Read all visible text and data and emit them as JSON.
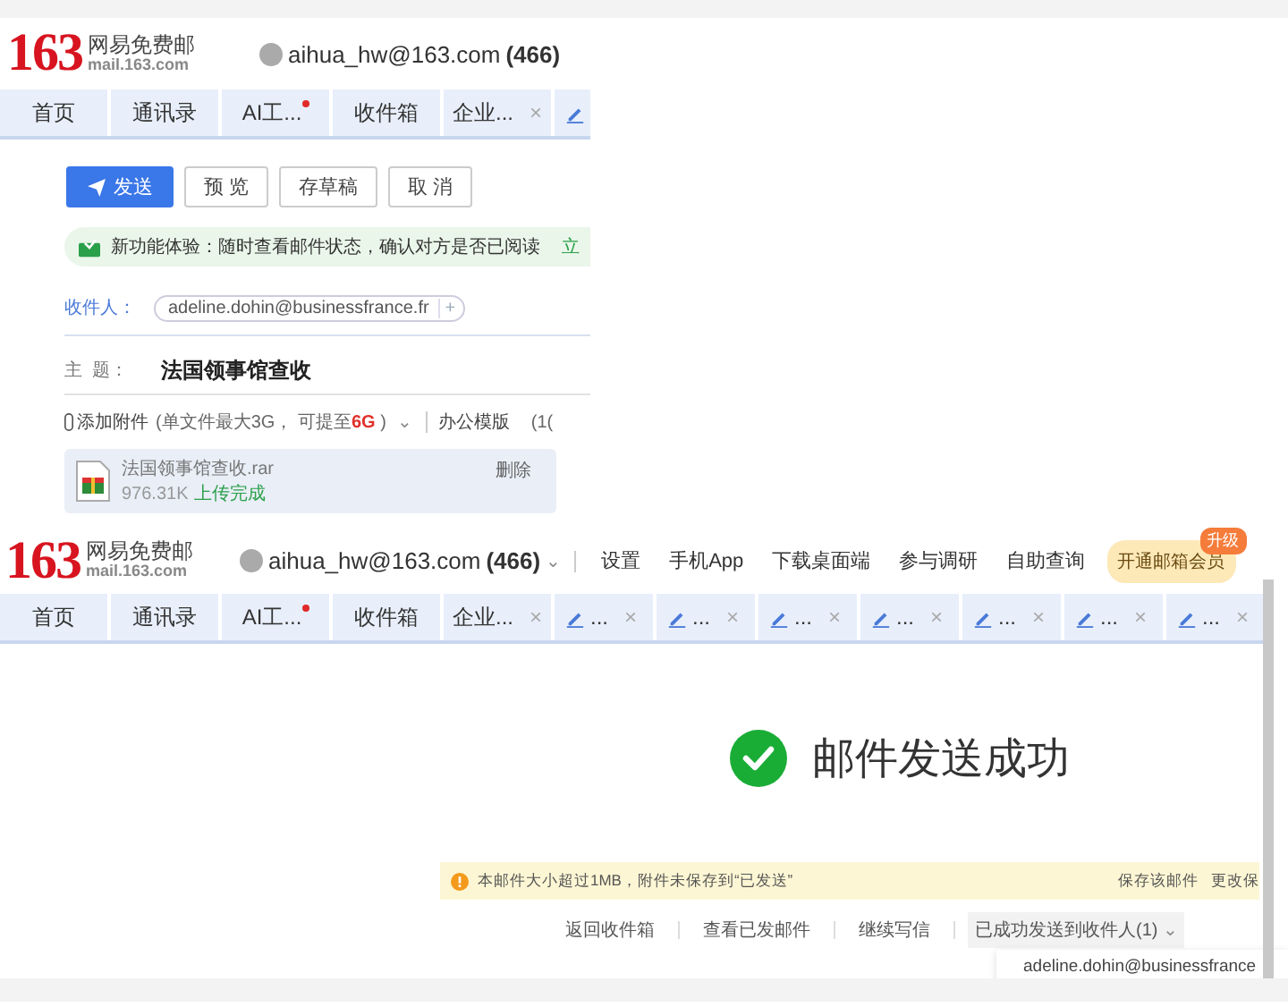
{
  "compose_screen": {
    "logo": {
      "number": "163",
      "name": "网易免费邮",
      "domain": "mail.163.com"
    },
    "account": {
      "email": "aihua_hw@163.com",
      "unread": "(466)"
    },
    "tabs": [
      {
        "kind": "text",
        "label": "首页",
        "dot": false,
        "closable": false
      },
      {
        "kind": "text",
        "label": "通讯录",
        "dot": false,
        "closable": false
      },
      {
        "kind": "text",
        "label": "AI工...",
        "dot": true,
        "closable": false
      },
      {
        "kind": "text",
        "label": "收件箱",
        "dot": false,
        "closable": false
      },
      {
        "kind": "text",
        "label": "企业...",
        "dot": false,
        "closable": true,
        "close": "×"
      },
      {
        "kind": "draft"
      }
    ],
    "toolbar": [
      {
        "kind": "primary",
        "label": "发送"
      },
      {
        "kind": "plain",
        "label": "预 览"
      },
      {
        "kind": "plain",
        "label": "存草稿"
      },
      {
        "kind": "plain",
        "label": "取 消"
      }
    ],
    "notice": {
      "text": "新功能体验：随时查看邮件状态，确认对方是否已阅读",
      "link": "立"
    },
    "recipient": {
      "label": "收件人：",
      "chip": "adeline.dohin@businessfrance.fr",
      "add": "+"
    },
    "subject": {
      "label": "主  题：",
      "value": "法国领事馆查收"
    },
    "attach_bar": {
      "add": "添加附件",
      "limit": "(单文件最大3G， 可提至**6G** )",
      "caret": "⌄",
      "template": "办公模版",
      "more": "(1("
    },
    "attachment": {
      "name": "法国领事馆查收.rar",
      "size": "976.31K",
      "status": "上传完成",
      "delete": "删除"
    }
  },
  "sent_screen": {
    "logo": {
      "number": "163",
      "name": "网易免费邮",
      "domain": "mail.163.com"
    },
    "account": {
      "email": "aihua_hw@163.com",
      "unread": "(466)",
      "caret": "⌄"
    },
    "nav": [
      "设置",
      "手机App",
      "下载桌面端",
      "参与调研",
      "自助查询"
    ],
    "vip": {
      "label": "开通邮箱会员",
      "badge": "升级"
    },
    "tabs": [
      {
        "kind": "text",
        "label": "首页",
        "dot": false,
        "closable": false
      },
      {
        "kind": "text",
        "label": "通讯录",
        "dot": false,
        "closable": false
      },
      {
        "kind": "text",
        "label": "AI工...",
        "dot": true,
        "closable": false
      },
      {
        "kind": "text",
        "label": "收件箱",
        "dot": false,
        "closable": false
      },
      {
        "kind": "text",
        "label": "企业...",
        "dot": false,
        "closable": true,
        "close": "×"
      },
      {
        "kind": "draft",
        "label": "...",
        "dot": false,
        "closable": true,
        "close": "×"
      },
      {
        "kind": "draft",
        "label": "...",
        "dot": false,
        "closable": true,
        "close": "×"
      },
      {
        "kind": "draft",
        "label": "...",
        "dot": false,
        "closable": true,
        "close": "×"
      },
      {
        "kind": "draft",
        "label": "...",
        "dot": false,
        "closable": true,
        "close": "×"
      },
      {
        "kind": "draft",
        "label": "...",
        "dot": false,
        "closable": true,
        "close": "×"
      },
      {
        "kind": "draft",
        "label": "...",
        "dot": false,
        "closable": true,
        "close": "×"
      },
      {
        "kind": "draft",
        "label": "...",
        "dot": false,
        "closable": true,
        "close": "×"
      }
    ],
    "success": "邮件发送成功",
    "warning": {
      "text": "本邮件大小超过1MB，附件未保存到“已发送”",
      "actions": [
        "保存该邮件",
        "更改保"
      ]
    },
    "links": [
      {
        "kind": "link",
        "label": "返回收件箱"
      },
      {
        "kind": "link",
        "label": "查看已发邮件"
      },
      {
        "kind": "link",
        "label": "继续写信"
      },
      {
        "kind": "dropdown",
        "label": "已成功发送到收件人(1)",
        "caret": "⌄"
      }
    ],
    "recipients": [
      "adeline.dohin@businessfrance"
    ]
  }
}
